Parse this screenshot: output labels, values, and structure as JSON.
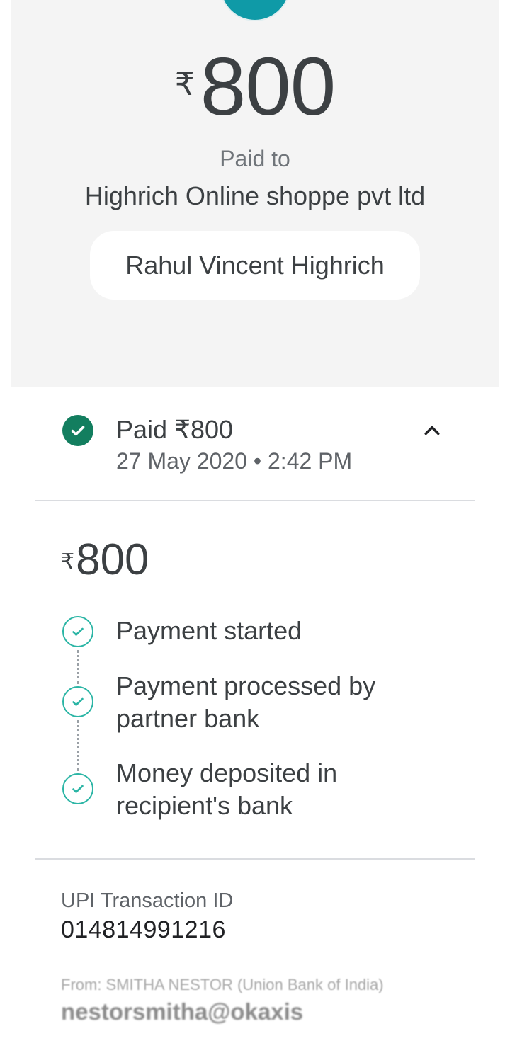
{
  "header": {
    "currency_symbol": "₹",
    "amount": "800",
    "paid_to_label": "Paid to",
    "merchant_name": "Highrich Online shoppe pvt ltd",
    "payer_chip": "Rahul Vincent Highrich"
  },
  "status": {
    "title": "Paid ₹800",
    "datetime": "27 May 2020 • 2:42 PM",
    "icon": "check-circle-icon",
    "expand_icon": "chevron-up-icon"
  },
  "details": {
    "currency_symbol": "₹",
    "amount": "800",
    "steps": [
      {
        "label": "Payment started",
        "icon": "check-outline-icon"
      },
      {
        "label": "Payment processed by partner bank",
        "icon": "check-outline-icon"
      },
      {
        "label": "Money deposited in recipient's bank",
        "icon": "check-outline-icon"
      }
    ]
  },
  "transaction": {
    "upi_label": "UPI Transaction ID",
    "upi_id": "014814991216",
    "from_text": "From: SMITHA NESTOR (Union Bank of India)",
    "vpa": "nestorsmitha@okaxis"
  },
  "colors": {
    "hero_bg": "#f4f4f4",
    "avatar": "#0f9aa7",
    "success_fill": "#137e5f",
    "step_accent": "#2bb5a5"
  }
}
